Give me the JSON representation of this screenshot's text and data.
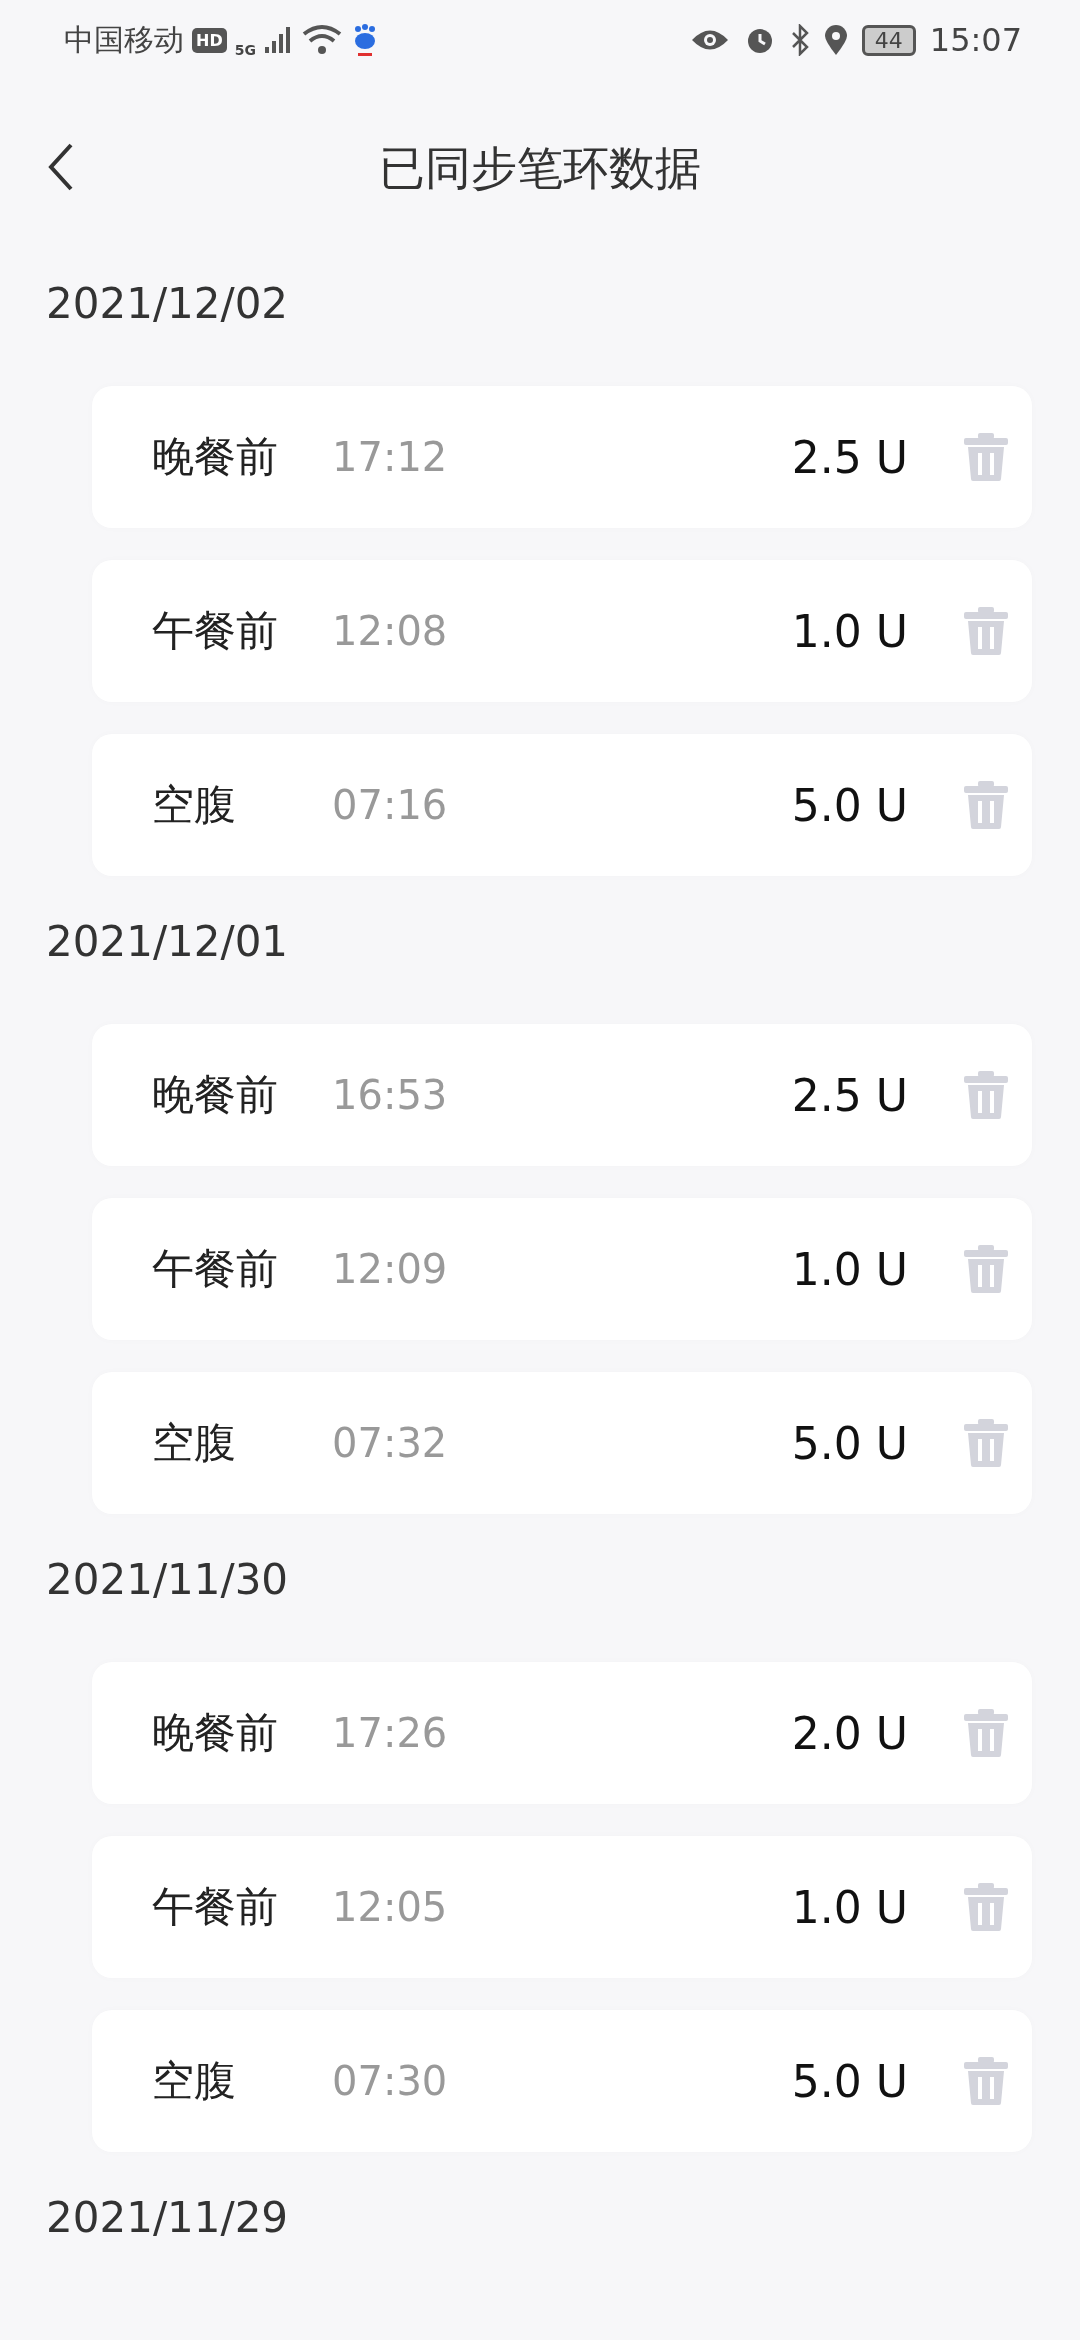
{
  "status_bar": {
    "carrier": "中国移动",
    "hd_badge": "HD",
    "network": "5G",
    "battery": "44",
    "time": "15:07"
  },
  "header": {
    "title": "已同步笔环数据"
  },
  "days": [
    {
      "date": "2021/12/02",
      "records": [
        {
          "meal": "晚餐前",
          "time": "17:12",
          "dose": "2.5 U"
        },
        {
          "meal": "午餐前",
          "time": "12:08",
          "dose": "1.0 U"
        },
        {
          "meal": "空腹",
          "time": "07:16",
          "dose": "5.0 U"
        }
      ]
    },
    {
      "date": "2021/12/01",
      "records": [
        {
          "meal": "晚餐前",
          "time": "16:53",
          "dose": "2.5 U"
        },
        {
          "meal": "午餐前",
          "time": "12:09",
          "dose": "1.0 U"
        },
        {
          "meal": "空腹",
          "time": "07:32",
          "dose": "5.0 U"
        }
      ]
    },
    {
      "date": "2021/11/30",
      "records": [
        {
          "meal": "晚餐前",
          "time": "17:26",
          "dose": "2.0 U"
        },
        {
          "meal": "午餐前",
          "time": "12:05",
          "dose": "1.0 U"
        },
        {
          "meal": "空腹",
          "time": "07:30",
          "dose": "5.0 U"
        }
      ]
    },
    {
      "date": "2021/11/29"
    }
  ]
}
